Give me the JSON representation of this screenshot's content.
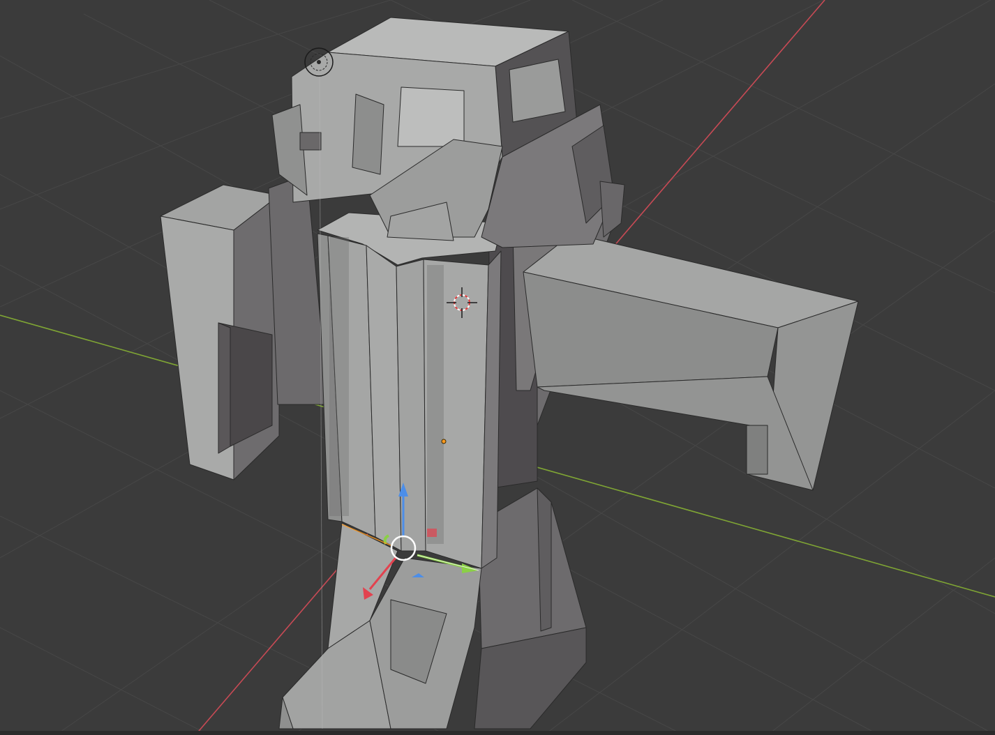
{
  "viewport": {
    "background": "#3b3b3b",
    "grid_color": "#474747",
    "x_axis_color": "#c84a55",
    "y_axis_color": "#7fa534",
    "mesh_light": "#a9aaa9",
    "mesh_mid": "#8f908f",
    "mesh_dark": "#5e5c5e",
    "mesh_edge": "#2a2a2a"
  },
  "gizmo": {
    "x_color": "#e2424f",
    "y_color": "#8bd046",
    "z_color": "#4c8ee8",
    "center_color": "#ffffff"
  },
  "cursor_3d": {
    "ring_color": "#e03a3a"
  },
  "origin_point": {
    "color": "#ff9a1f"
  }
}
